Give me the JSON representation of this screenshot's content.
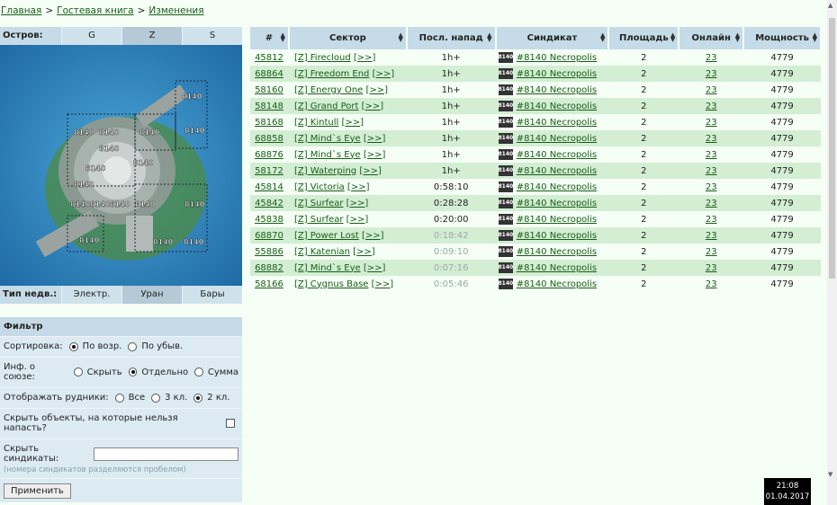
{
  "breadcrumbs": [
    {
      "label": "Главная"
    },
    {
      "label": "Гостевая книга"
    },
    {
      "label": "Изменения"
    }
  ],
  "island": {
    "label": "Остров:",
    "options": [
      "G",
      "Z",
      "S"
    ],
    "selected": "Z"
  },
  "resource": {
    "label": "Тип недв.:",
    "options": [
      "Электр.",
      "Уран",
      "Бары"
    ],
    "selected": "Уран"
  },
  "map_labels": [
    "8140"
  ],
  "filter": {
    "title": "Фильтр",
    "sort_label": "Сортировка:",
    "sort_options": [
      "По возр.",
      "По убыв."
    ],
    "union_label": "Инф. о союзе:",
    "union_options": [
      "Скрыть",
      "Отдельно",
      "Сумма"
    ],
    "mines_label": "Отображать рудники:",
    "mines_options": [
      "Все",
      "3 кл.",
      "2 кл."
    ],
    "hide_label": "Скрыть объекты, на которые нельзя напасть?",
    "hide_synd_label": "Скрыть синдикаты:",
    "hide_synd_value": "",
    "hint": "(номера синдикатов разделяются пробелом)",
    "apply_label": "Применить"
  },
  "table": {
    "headers": [
      "#",
      "Сектор",
      "Посл. напад",
      "Синдикат",
      "Площадь",
      "Онлайн",
      "Мощность"
    ],
    "rows": [
      {
        "id": "45812",
        "sector": "[Z] Firecloud",
        "last": "1h+",
        "synd": "#8140 Necropolis",
        "area": "2",
        "online": "23",
        "power": "4779",
        "faint": false
      },
      {
        "id": "68864",
        "sector": "[Z] Freedom End",
        "last": "1h+",
        "synd": "#8140 Necropolis",
        "area": "2",
        "online": "23",
        "power": "4779",
        "faint": false
      },
      {
        "id": "58160",
        "sector": "[Z] Energy One",
        "last": "1h+",
        "synd": "#8140 Necropolis",
        "area": "2",
        "online": "23",
        "power": "4779",
        "faint": false
      },
      {
        "id": "58148",
        "sector": "[Z] Grand Port",
        "last": "1h+",
        "synd": "#8140 Necropolis",
        "area": "2",
        "online": "23",
        "power": "4779",
        "faint": false
      },
      {
        "id": "58168",
        "sector": "[Z] Kintull",
        "last": "1h+",
        "synd": "#8140 Necropolis",
        "area": "2",
        "online": "23",
        "power": "4779",
        "faint": false
      },
      {
        "id": "68858",
        "sector": "[Z] Mind`s Eye",
        "last": "1h+",
        "synd": "#8140 Necropolis",
        "area": "2",
        "online": "23",
        "power": "4779",
        "faint": false
      },
      {
        "id": "68876",
        "sector": "[Z] Mind`s Eye",
        "last": "1h+",
        "synd": "#8140 Necropolis",
        "area": "2",
        "online": "23",
        "power": "4779",
        "faint": false
      },
      {
        "id": "58172",
        "sector": "[Z] Waterping",
        "last": "1h+",
        "synd": "#8140 Necropolis",
        "area": "2",
        "online": "23",
        "power": "4779",
        "faint": false
      },
      {
        "id": "45814",
        "sector": "[Z] Victoria",
        "last": "0:58:10",
        "synd": "#8140 Necropolis",
        "area": "2",
        "online": "23",
        "power": "4779",
        "faint": false
      },
      {
        "id": "45842",
        "sector": "[Z] Surfear",
        "last": "0:28:28",
        "synd": "#8140 Necropolis",
        "area": "2",
        "online": "23",
        "power": "4779",
        "faint": false
      },
      {
        "id": "45838",
        "sector": "[Z] Surfear",
        "last": "0:20:00",
        "synd": "#8140 Necropolis",
        "area": "2",
        "online": "23",
        "power": "4779",
        "faint": false
      },
      {
        "id": "68870",
        "sector": "[Z] Power Lost",
        "last": "0:18:42",
        "synd": "#8140 Necropolis",
        "area": "2",
        "online": "23",
        "power": "4779",
        "faint": true
      },
      {
        "id": "55886",
        "sector": "[Z] Katenian",
        "last": "0:09:10",
        "synd": "#8140 Necropolis",
        "area": "2",
        "online": "23",
        "power": "4779",
        "faint": true
      },
      {
        "id": "68882",
        "sector": "[Z] Mind`s Eye",
        "last": "0:07:16",
        "synd": "#8140 Necropolis",
        "area": "2",
        "online": "23",
        "power": "4779",
        "faint": true
      },
      {
        "id": "58166",
        "sector": "[Z] Cygnus Base",
        "last": "0:05:46",
        "synd": "#8140 Necropolis",
        "area": "2",
        "online": "23",
        "power": "4779",
        "faint": true
      }
    ],
    "more_link": "[>>]",
    "synd_icon": "8140"
  },
  "clock": {
    "time": "21:08",
    "date": "01.04.2017"
  }
}
